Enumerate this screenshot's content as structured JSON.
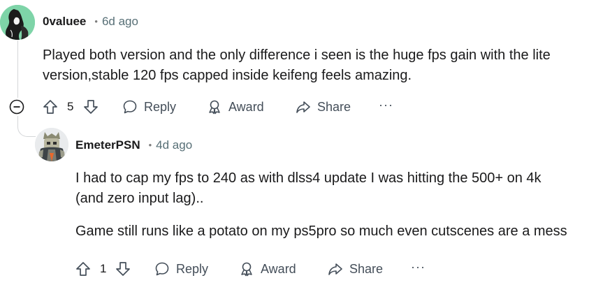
{
  "comments": [
    {
      "author": "0valuee",
      "separator": "•",
      "time": "6d ago",
      "lines": [
        "Played both version and the only difference i seen is the huge fps gain with the lite",
        "version,stable 120 fps capped inside keifeng feels amazing."
      ],
      "votes": "5",
      "reply_label": "Reply",
      "award_label": "Award",
      "share_label": "Share",
      "more_label": "···"
    },
    {
      "author": "EmeterPSN",
      "separator": "•",
      "time": "4d ago",
      "lines": [
        "I had to cap my fps to 240 as with dlss4 update I was hitting the 500+ on 4k",
        "(and zero input lag)..",
        "Game still runs like a potato on my ps5pro so much even cutscenes are a mess"
      ],
      "votes": "1",
      "reply_label": "Reply",
      "award_label": "Award",
      "share_label": "Share",
      "more_label": "···"
    }
  ],
  "icons": {
    "collapse": "minus-circle-icon",
    "upvote": "arrow-up-icon",
    "downvote": "arrow-down-icon",
    "reply": "speech-bubble-icon",
    "award": "award-icon",
    "share": "share-arrow-icon",
    "more": "ellipsis-icon"
  },
  "colors": {
    "avatar_1_bg": "#7ed4a8",
    "action_text": "#444e59",
    "time_text": "#576f76",
    "thread_line": "#d4d6d8"
  }
}
